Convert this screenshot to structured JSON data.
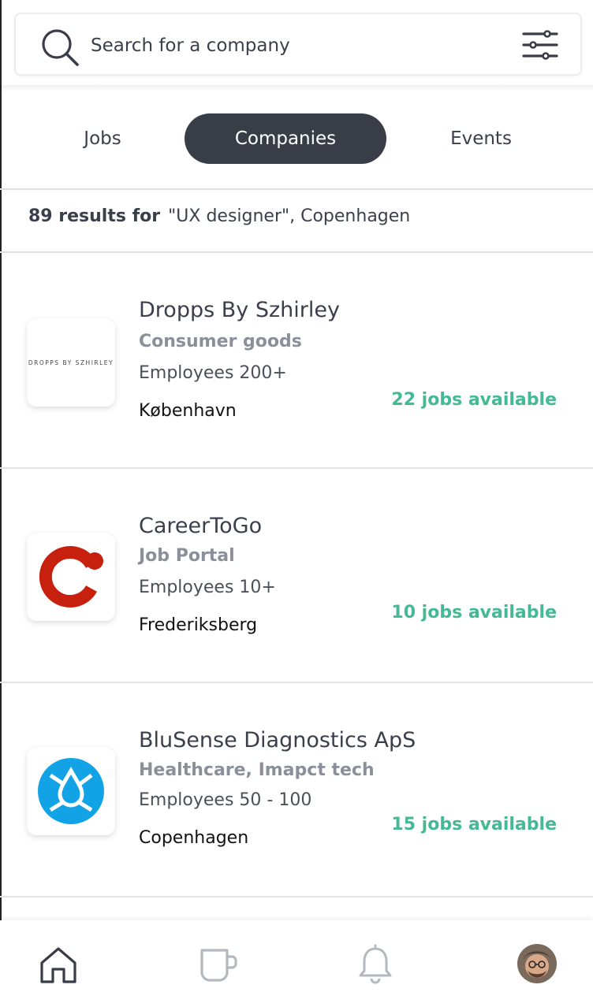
{
  "search": {
    "placeholder": "Search for a company"
  },
  "tabs": [
    {
      "label": "Jobs",
      "active": false
    },
    {
      "label": "Companies",
      "active": true
    },
    {
      "label": "Events",
      "active": false
    }
  ],
  "results": {
    "count_label": "89 results for",
    "query": "\"UX designer\", Copenhagen"
  },
  "companies": [
    {
      "name": "Dropps By Szhirley",
      "industry": "Consumer goods",
      "employees": "Employees 200+",
      "location": "København",
      "jobs": "22 jobs available",
      "logo_text": "DROPPS BY SZHIRLEY"
    },
    {
      "name": "CareerToGo",
      "industry": "Job Portal",
      "employees": "Employees 10+",
      "location": "Frederiksberg",
      "jobs": "10 jobs available"
    },
    {
      "name": "BluSense Diagnostics ApS",
      "industry": "Healthcare, Imapct tech",
      "employees": "Employees 50 - 100",
      "location": "Copenhagen",
      "jobs": "15 jobs available"
    }
  ],
  "nav": {
    "items": [
      {
        "icon": "home-icon",
        "active": true
      },
      {
        "icon": "cup-icon",
        "active": false
      },
      {
        "icon": "bell-icon",
        "active": false
      },
      {
        "icon": "avatar",
        "active": false
      }
    ]
  },
  "colors": {
    "accent_green": "#45b894",
    "active_tab_bg": "#383d48",
    "text_dark": "#3a3f4b",
    "text_muted": "#8a8f9a",
    "careertogo_red": "#c8200f",
    "blusense_blue": "#12a3e6"
  }
}
